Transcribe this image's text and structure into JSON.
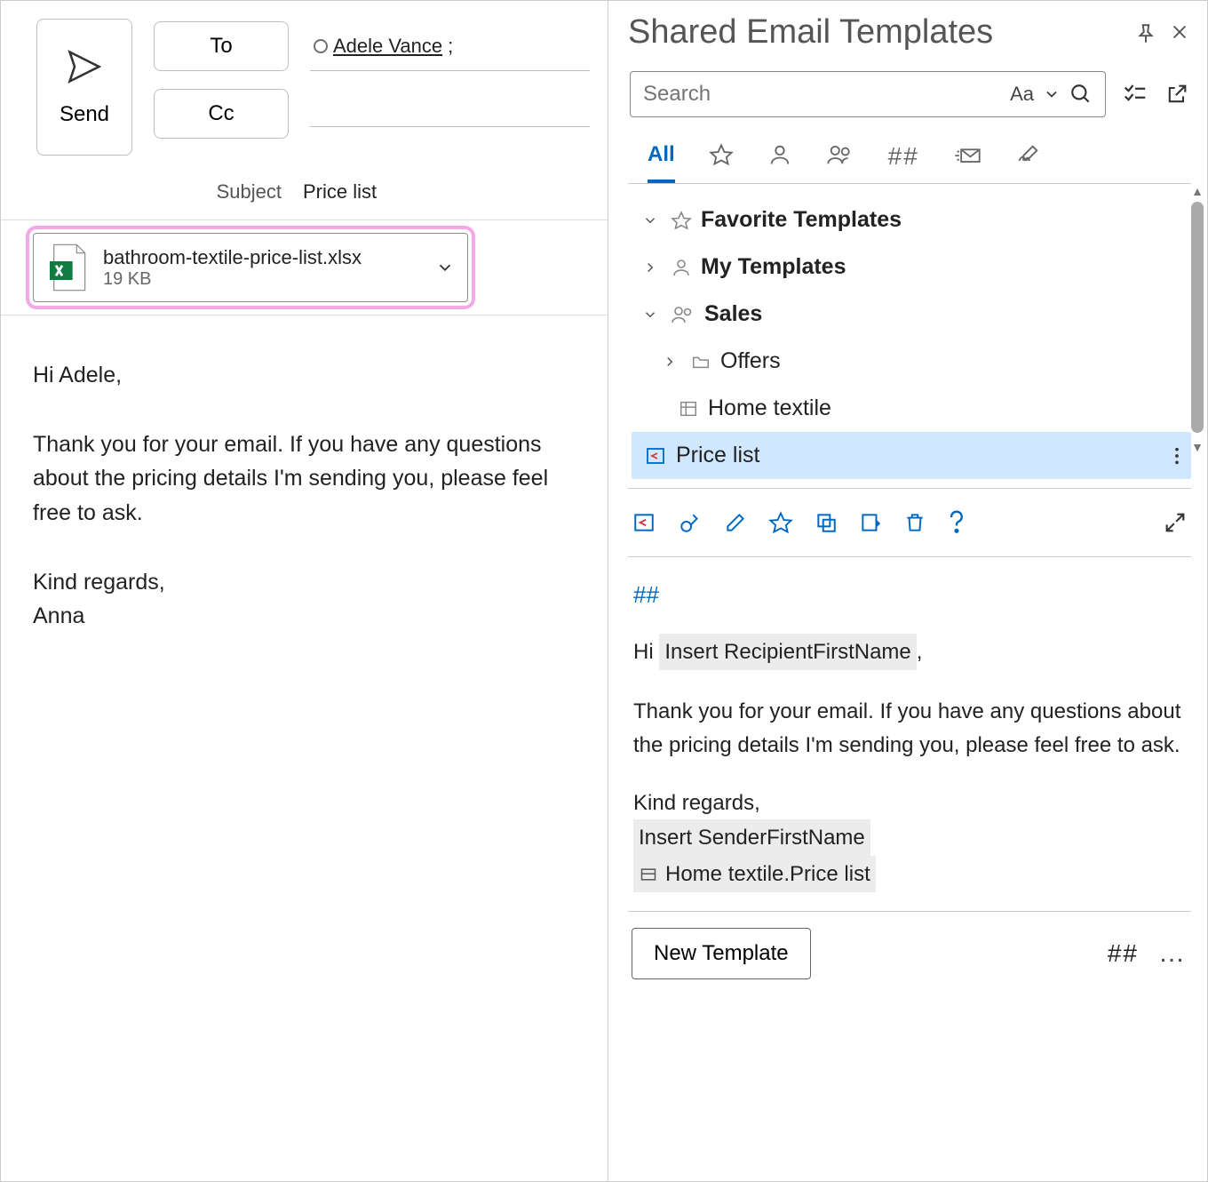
{
  "compose": {
    "send_label": "Send",
    "to_label": "To",
    "cc_label": "Cc",
    "recipient": "Adele Vance",
    "subject_label": "Subject",
    "subject_value": "Price list",
    "attachment": {
      "name": "bathroom-textile-price-list.xlsx",
      "size": "19 KB"
    },
    "body": "Hi Adele,\n\nThank you for your email. If you have any questions about the pricing details I'm sending you, please feel free to ask.\n\nKind regards,\nAnna"
  },
  "pane": {
    "title": "Shared Email Templates",
    "search_placeholder": "Search",
    "aa_label": "Aa",
    "filter_all": "All",
    "tree": {
      "favorites": "Favorite Templates",
      "my_templates": "My Templates",
      "sales": "Sales",
      "offers": "Offers",
      "home_textile": "Home textile",
      "price_list": "Price list"
    },
    "preview": {
      "hash": "##",
      "hi": "Hi",
      "placeholder_recipient": "Insert RecipientFirstName",
      "body": "Thank you for your email. If you have any questions about the pricing details I'm sending you, please feel free to ask.",
      "kind_regards": "Kind regards,",
      "placeholder_sender": "Insert SenderFirstName",
      "linked_item": "Home textile.Price list"
    },
    "new_template": "New Template",
    "hash_btn": "##"
  }
}
